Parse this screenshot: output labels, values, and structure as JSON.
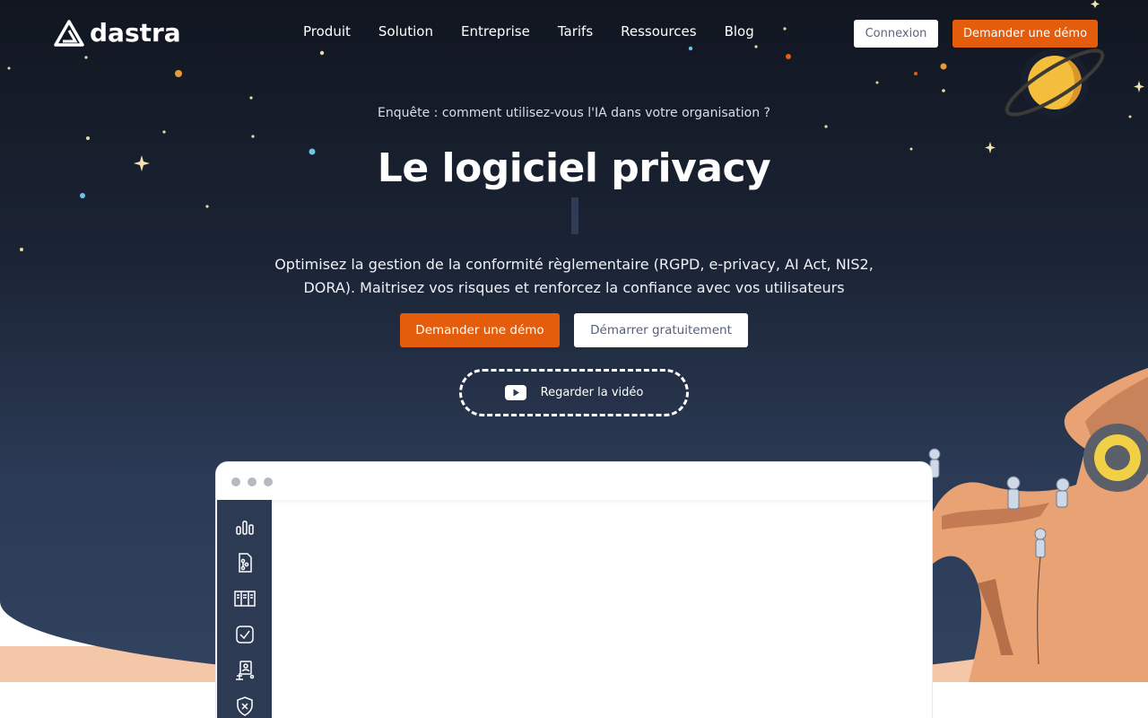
{
  "brand": {
    "name": "dastra"
  },
  "nav": {
    "items": [
      "Produit",
      "Solution",
      "Entreprise",
      "Tarifs",
      "Ressources",
      "Blog"
    ],
    "login_label": "Connexion",
    "demo_label": "Demander une démo"
  },
  "hero": {
    "survey_label": "Enquête : comment utilisez-vous l'IA dans votre organisation ?",
    "title": "Le logiciel privacy",
    "subtitle_line1": "Optimisez la gestion de la conformité règlementaire (RGPD, e-privacy, AI Act, NIS2,",
    "subtitle_line2": "DORA). Maitrisez vos risques et renforcez la confiance avec vos utilisateurs",
    "cta_demo": "Demander une démo",
    "cta_free": "Démarrer gratuitement",
    "cta_video": "Regarder la vidéo"
  },
  "mockup": {
    "sidebar_icons": [
      "bar-chart-icon",
      "document-tree-icon",
      "register-icon",
      "checklist-icon",
      "user-network-icon",
      "shield-x-icon"
    ]
  },
  "colors": {
    "accent": "#e35d0d",
    "hero_top": "#111620",
    "hero_bottom": "#32435f",
    "sidebar": "#2d3a54"
  }
}
